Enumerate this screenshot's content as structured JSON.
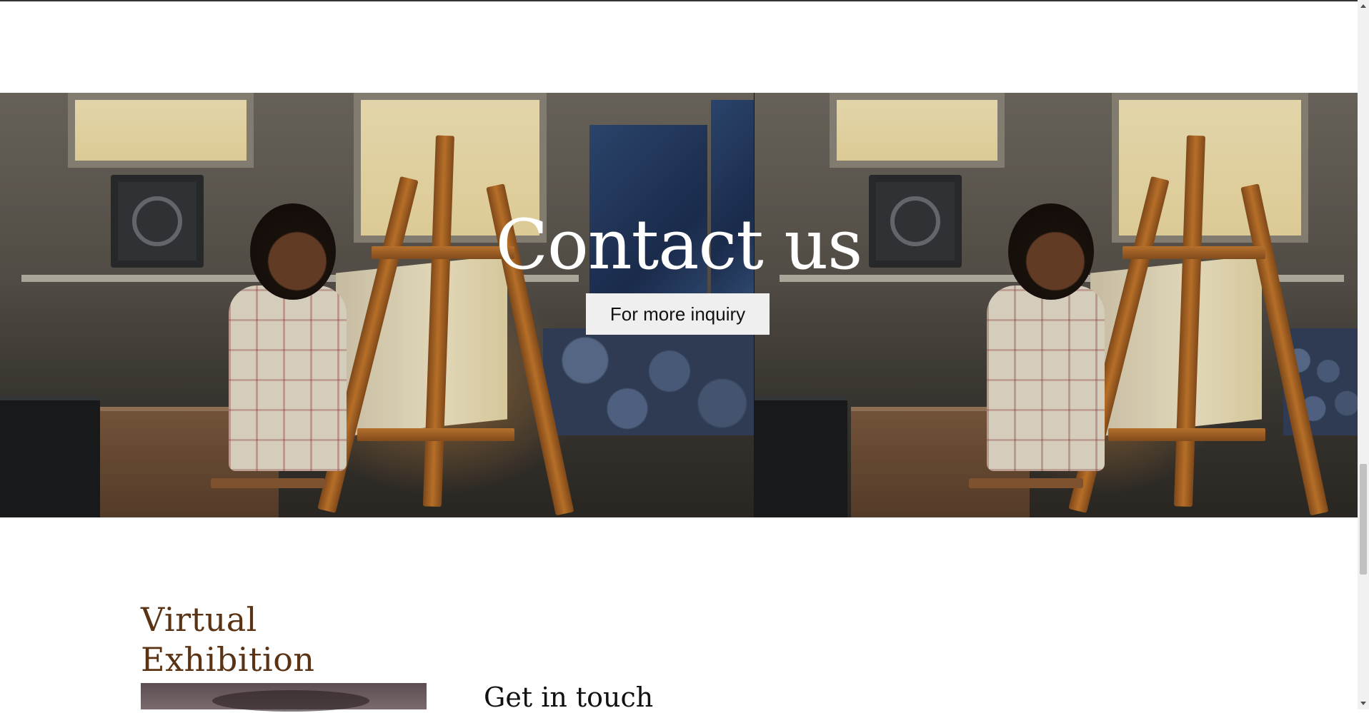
{
  "hero": {
    "title": "Contact us",
    "button_label": "For more inquiry",
    "image_description_icon": "artist-painting-photo"
  },
  "exhibition": {
    "title": "Virtual Exhibition"
  },
  "contact": {
    "heading": "Get in touch"
  },
  "colors": {
    "section_title": "#5a3314",
    "button_bg": "#efefef",
    "hero_text": "#ffffff"
  }
}
